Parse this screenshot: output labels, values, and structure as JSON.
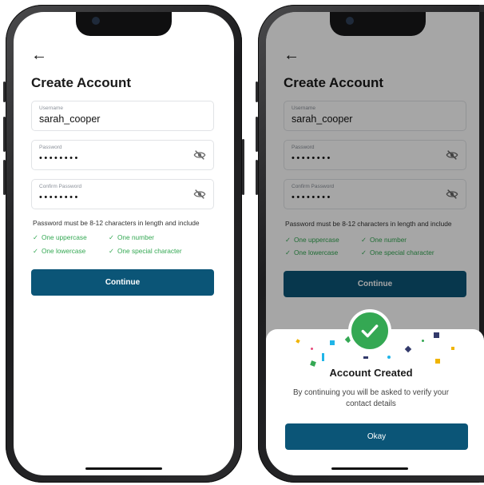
{
  "signup": {
    "title": "Create Account",
    "username_label": "Username",
    "username_value": "sarah_cooper",
    "password_label": "Password",
    "password_value": "••••••••",
    "confirm_label": "Confirm Password",
    "confirm_value": "••••••••",
    "rule_text": "Password must be 8-12 characters in length and include",
    "requirements": [
      "One uppercase",
      "One number",
      "One lowercase",
      "One special character"
    ],
    "continue_label": "Continue"
  },
  "modal": {
    "title": "Account Created",
    "description": "By continuing you will be asked to verify your contact details",
    "button_label": "Okay"
  },
  "icons": {
    "back": "arrow-left-icon",
    "eye": "eye-slash-icon",
    "check": "checkmark-icon",
    "success": "success-check-icon"
  },
  "colors": {
    "primary": "#0b5577",
    "success": "#34a853",
    "text": "#1a1a1a"
  }
}
